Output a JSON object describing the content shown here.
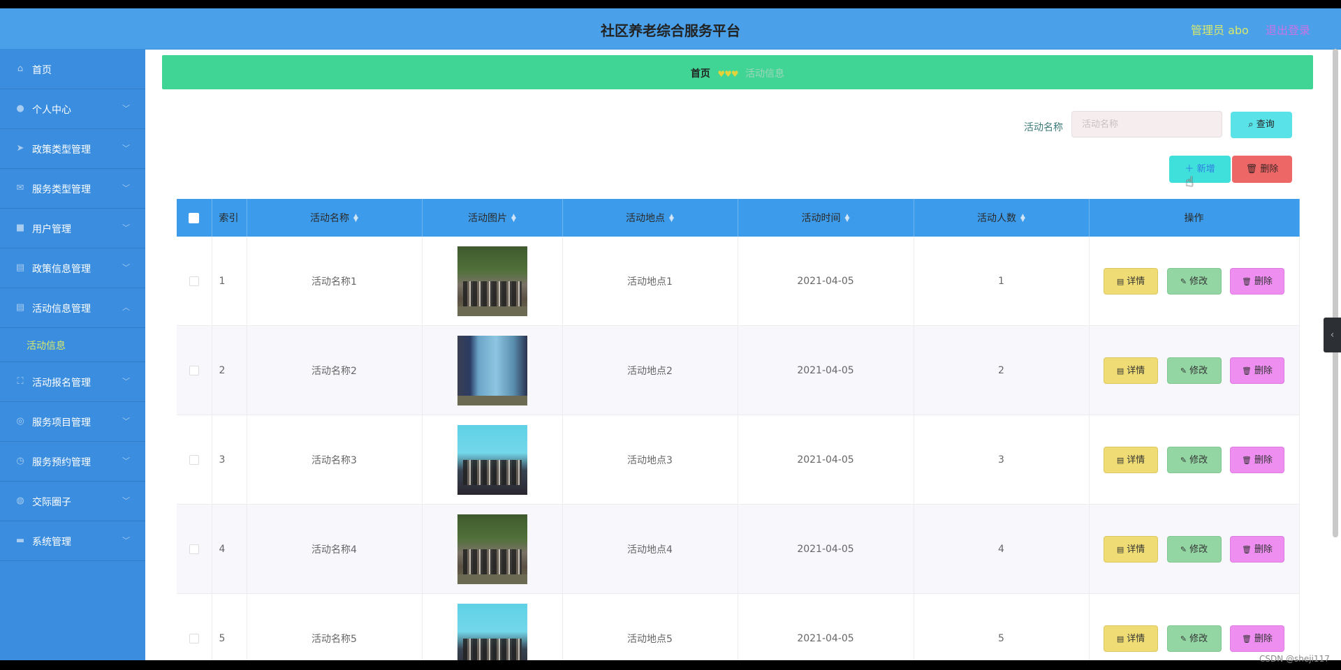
{
  "header": {
    "title": "社区养老综合服务平台",
    "user": "管理员 abo",
    "logout": "退出登录"
  },
  "sidebar": {
    "items": [
      {
        "label": "首页",
        "icon": "home-icon"
      },
      {
        "label": "个人中心",
        "icon": "user-icon"
      },
      {
        "label": "政策类型管理",
        "icon": "send-icon"
      },
      {
        "label": "服务类型管理",
        "icon": "mail-icon"
      },
      {
        "label": "用户管理",
        "icon": "briefcase-icon"
      },
      {
        "label": "政策信息管理",
        "icon": "clipboard-icon"
      },
      {
        "label": "活动信息管理",
        "icon": "clipboard-icon"
      },
      {
        "label": "活动报名管理",
        "icon": "fullscreen-icon"
      },
      {
        "label": "服务项目管理",
        "icon": "globe-icon"
      },
      {
        "label": "服务预约管理",
        "icon": "clock-icon"
      },
      {
        "label": "交际圈子",
        "icon": "compass-icon"
      },
      {
        "label": "系统管理",
        "icon": "ticket-icon"
      }
    ],
    "active_sub": "活动信息"
  },
  "breadcrumb": {
    "home": "首页",
    "separator": "♥♥♥",
    "current": "活动信息"
  },
  "search": {
    "label": "活动名称",
    "placeholder": "活动名称",
    "query_button": "查询"
  },
  "actions": {
    "add": "新增",
    "delete": "删除"
  },
  "table": {
    "headers": {
      "index": "索引",
      "name": "活动名称",
      "image": "活动图片",
      "place": "活动地点",
      "time": "活动时间",
      "count": "活动人数",
      "ops": "操作"
    },
    "rows": [
      {
        "index": "1",
        "name": "活动名称1",
        "place": "活动地点1",
        "time": "2021-04-05",
        "count": "1"
      },
      {
        "index": "2",
        "name": "活动名称2",
        "place": "活动地点2",
        "time": "2021-04-05",
        "count": "2"
      },
      {
        "index": "3",
        "name": "活动名称3",
        "place": "活动地点3",
        "time": "2021-04-05",
        "count": "3"
      },
      {
        "index": "4",
        "name": "活动名称4",
        "place": "活动地点4",
        "time": "2021-04-05",
        "count": "4"
      },
      {
        "index": "5",
        "name": "活动名称5",
        "place": "活动地点5",
        "time": "2021-04-05",
        "count": "5"
      }
    ],
    "row_buttons": {
      "detail": "详情",
      "edit": "修改",
      "delete": "删除"
    }
  },
  "watermark": "CSDN @sheji117",
  "colors": {
    "header": "#4aa1ea",
    "sidebar": "#3a8ddf",
    "breadcrumb": "#40d595",
    "table_header": "#3c9bea"
  }
}
